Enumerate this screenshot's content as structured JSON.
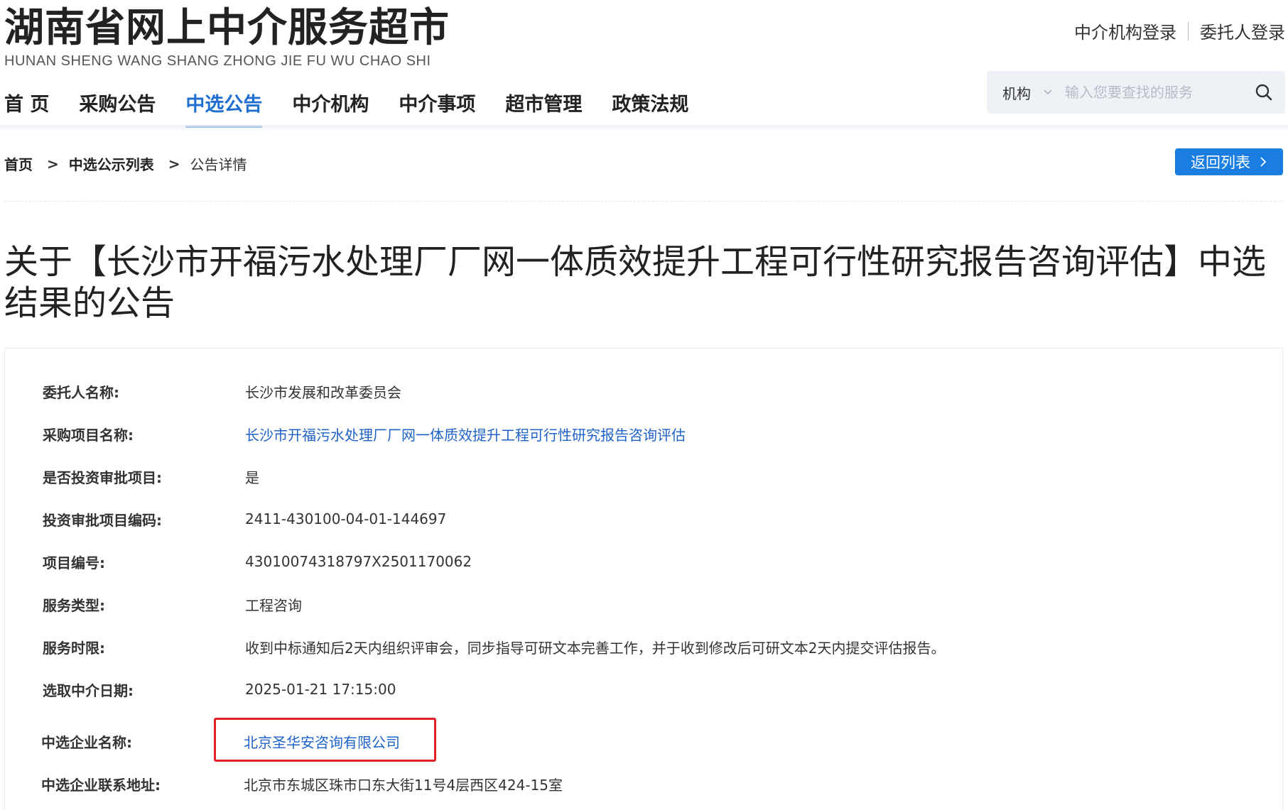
{
  "header": {
    "site_title": "湖南省网上中介服务超市",
    "site_subtitle": "HUNAN SHENG WANG SHANG ZHONG JIE FU WU CHAO SHI",
    "login_agency": "中介机构登录",
    "login_client": "委托人登录"
  },
  "nav": {
    "items": [
      {
        "label": "首 页",
        "active": false
      },
      {
        "label": "采购公告",
        "active": false
      },
      {
        "label": "中选公告",
        "active": true
      },
      {
        "label": "中介机构",
        "active": false
      },
      {
        "label": "中介事项",
        "active": false
      },
      {
        "label": "超市管理",
        "active": false
      },
      {
        "label": "政策法规",
        "active": false
      }
    ]
  },
  "search": {
    "category": "机构",
    "placeholder": "输入您要查找的服务"
  },
  "breadcrumb": {
    "home": "首页",
    "list": "中选公示列表",
    "current": "公告详情",
    "separator": ">"
  },
  "back_button": "返回列表",
  "page_title": "关于【长沙市开福污水处理厂厂网一体质效提升工程可行性研究报告咨询评估】中选结果的公告",
  "details": [
    {
      "label": "委托人名称:",
      "value": "长沙市发展和改革委员会",
      "link": false
    },
    {
      "label": "采购项目名称:",
      "value": "长沙市开福污水处理厂厂网一体质效提升工程可行性研究报告咨询评估",
      "link": true
    },
    {
      "label": "是否投资审批项目:",
      "value": "是",
      "link": false
    },
    {
      "label": "投资审批项目编码:",
      "value": "2411-430100-04-01-144697",
      "link": false
    },
    {
      "label": "项目编号:",
      "value": "43010074318797X2501170062",
      "link": false
    },
    {
      "label": "服务类型:",
      "value": "工程咨询",
      "link": false
    },
    {
      "label": "服务时限:",
      "value": "收到中标通知后2天内组织评审会，同步指导可研文本完善工作，并于收到修改后可研文本2天内提交评估报告。",
      "link": false
    },
    {
      "label": "选取中介日期:",
      "value": "2025-01-21 17:15:00",
      "link": false
    },
    {
      "label": "中选企业名称:",
      "value": "北京圣华安咨询有限公司",
      "link": true
    },
    {
      "label": "中选企业联系地址:",
      "value": "北京市东城区珠市口东大街11号4层西区424-15室",
      "link": false
    }
  ],
  "colors": {
    "accent": "#1f6fd0",
    "button": "#1a7ee0",
    "link": "#1f62c7",
    "highlight": "#e21f26"
  },
  "icons": {
    "search": "search-icon",
    "dropdown": "chevron-down-icon",
    "back": "chevron-right-icon"
  }
}
